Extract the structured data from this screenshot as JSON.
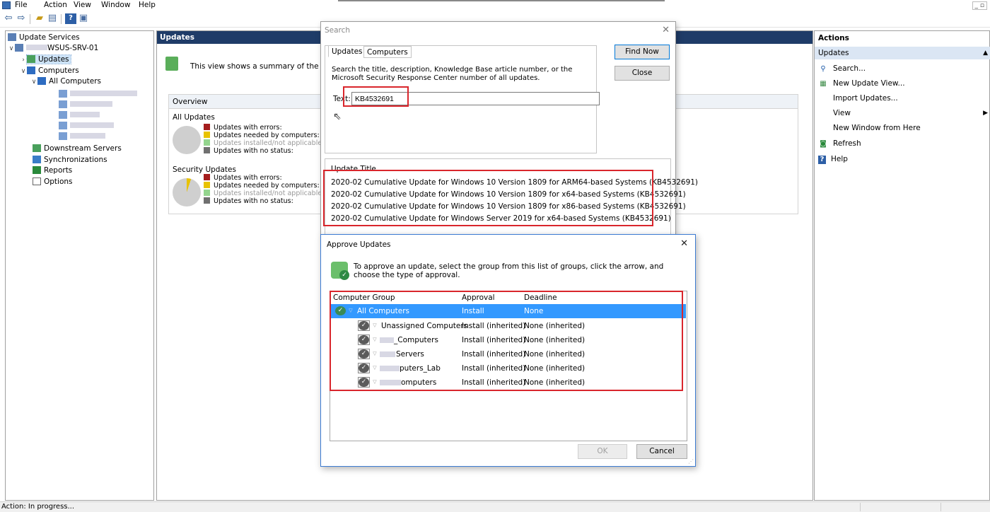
{
  "menubar": {
    "items": [
      "File",
      "Action",
      "View",
      "Window",
      "Help"
    ],
    "window_controls": "_ ▫"
  },
  "tree": {
    "root": "Update Services",
    "server": "WSUS-SRV-01",
    "updates": "Updates",
    "computers": "Computers",
    "all_computers": "All Computers",
    "downstream": "Downstream Servers",
    "sync": "Synchronizations",
    "reports": "Reports",
    "options": "Options"
  },
  "center": {
    "header": "Updates",
    "summary": "This view shows a summary of the statu",
    "overview": {
      "title": "Overview",
      "all_updates": "All Updates",
      "security_updates": "Security Updates",
      "legend": [
        {
          "label": "Updates with errors:",
          "color": "#a41d1d"
        },
        {
          "label": "Updates needed by computers:",
          "color": "#e8c200"
        },
        {
          "label": "Updates installed/not applicable",
          "color": "#94d58e"
        },
        {
          "label": "Updates with no status:",
          "color": "#707070"
        }
      ]
    }
  },
  "actions": {
    "title": "Actions",
    "section": "Updates",
    "items": [
      {
        "label": "Search...",
        "icon": "search-icon"
      },
      {
        "label": "New Update View...",
        "icon": "new-view-icon"
      },
      {
        "label": "Import Updates...",
        "icon": ""
      },
      {
        "label": "View",
        "icon": "",
        "submenu": true
      },
      {
        "label": "New Window from Here",
        "icon": ""
      },
      {
        "label": "Refresh",
        "icon": "refresh-icon"
      },
      {
        "label": "Help",
        "icon": "help-icon"
      }
    ]
  },
  "status": {
    "text": "Action:  In progress..."
  },
  "search_dialog": {
    "title": "Search",
    "tabs": [
      "Updates",
      "Computers"
    ],
    "instructions": "Search the title, description, Knowledge Base article number, or the Microsoft Security Response Center number of all updates.",
    "text_label": "Text:",
    "text_value": "KB4532691",
    "find_now": "Find Now",
    "close": "Close",
    "results_header": "Update Title",
    "results": [
      "2020-02 Cumulative Update for Windows 10 Version 1809 for ARM64-based Systems (KB4532691)",
      "2020-02 Cumulative Update for Windows 10 Version 1809 for x64-based Systems (KB4532691)",
      "2020-02 Cumulative Update for Windows 10 Version 1809 for x86-based Systems (KB4532691)",
      "2020-02 Cumulative Update for Windows Server 2019 for x64-based Systems (KB4532691)"
    ]
  },
  "approve_dialog": {
    "title": "Approve Updates",
    "message": "To approve an update, select the group from this list of groups, click the arrow, and choose the type of approval.",
    "columns": [
      "Computer Group",
      "Approval",
      "Deadline"
    ],
    "rows": [
      {
        "group": "All Computers",
        "approval": "Install",
        "deadline": "None",
        "selected": true
      },
      {
        "group": "Unassigned Computers",
        "approval": "Install (inherited)",
        "deadline": "None (inherited)"
      },
      {
        "group": "_Computers",
        "approval": "Install (inherited)",
        "deadline": "None (inherited)"
      },
      {
        "group": "Servers",
        "approval": "Install (inherited)",
        "deadline": "None (inherited)"
      },
      {
        "group": "puters_Lab",
        "approval": "Install (inherited)",
        "deadline": "None (inherited)"
      },
      {
        "group": "omputers",
        "approval": "Install (inherited)",
        "deadline": "None (inherited)"
      }
    ],
    "ok": "OK",
    "cancel": "Cancel"
  },
  "colors": {
    "highlight": "#d9262c",
    "selection": "#3399ff",
    "header_bar": "#1f3c68"
  }
}
